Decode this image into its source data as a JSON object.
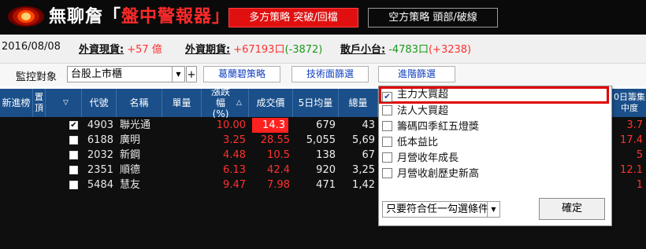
{
  "header": {
    "title_prefix": "無聊詹「",
    "title_highlight": "盤中警報器",
    "title_suffix": "」",
    "long_strategy": "多方策略 突破/回檔",
    "short_strategy": "空方策略 頭部/破線"
  },
  "info": {
    "date": "2016/08/08",
    "foreign_spot_label": "外資現貨:",
    "foreign_spot_value": "+57 億",
    "foreign_futures_label": "外資期貨:",
    "foreign_futures_value": "+67193口",
    "foreign_futures_change": "(-3872)",
    "retail_label": "散戶小台:",
    "retail_value": "-4783口",
    "retail_change": "(+3238)"
  },
  "controls": {
    "monitor_label": "監控對象",
    "market_value": "台股上市櫃",
    "plus_label": "+",
    "tabs": [
      "葛蘭碧策略",
      "技術面篩選",
      "進階篩選"
    ]
  },
  "table": {
    "headers": [
      "新進榜",
      "置頂",
      "代號",
      "名稱",
      "單量",
      "漲跌幅(%)",
      "成交價",
      "5日均量",
      "總量",
      "",
      "0日籌集中度"
    ],
    "rows": [
      {
        "pinned": true,
        "code": "4903",
        "name": "聯光通",
        "pct": "10.00",
        "price": "14.3",
        "avg5": "679",
        "total": "43",
        "right": "3.7"
      },
      {
        "pinned": false,
        "code": "6188",
        "name": "廣明",
        "pct": "3.25",
        "price": "28.55",
        "avg5": "5,055",
        "total": "5,69",
        "right": "17.4"
      },
      {
        "pinned": false,
        "code": "2032",
        "name": "新鋼",
        "pct": "4.48",
        "price": "10.5",
        "avg5": "138",
        "total": "67",
        "right": "5"
      },
      {
        "pinned": false,
        "code": "2351",
        "name": "順德",
        "pct": "6.13",
        "price": "42.4",
        "avg5": "920",
        "total": "3,25",
        "right": "12.1"
      },
      {
        "pinned": false,
        "code": "5484",
        "name": "慧友",
        "pct": "9.47",
        "price": "7.98",
        "avg5": "471",
        "total": "1,42",
        "right": "1"
      }
    ]
  },
  "panel": {
    "options": [
      {
        "label": "主力大買超",
        "checked": true
      },
      {
        "label": "法人大買超",
        "checked": false
      },
      {
        "label": "籌碼四季紅五燈獎",
        "checked": false
      },
      {
        "label": "低本益比",
        "checked": false
      },
      {
        "label": "月營收年成長",
        "checked": false
      },
      {
        "label": "月營收創歷史新高",
        "checked": false
      }
    ],
    "mode": "只要符合任一勾選條件",
    "ok_label": "確定"
  },
  "colors": {
    "title_red": "#ff2a2a",
    "header_blue": "#1a4f8a",
    "up_red": "#ff3030",
    "down_green": "#1a9a1a"
  }
}
